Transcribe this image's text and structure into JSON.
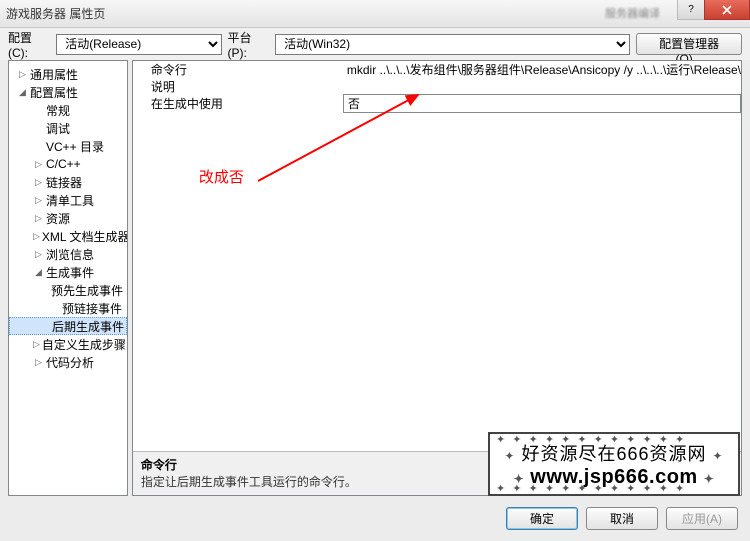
{
  "window": {
    "title": "游戏服务器 属性页",
    "blurred_hint": "服务器编译"
  },
  "toolbar": {
    "config_label": "配置(C):",
    "config_value": "活动(Release)",
    "platform_label": "平台(P):",
    "platform_value": "活动(Win32)",
    "manager_button": "配置管理器(O)..."
  },
  "tree": [
    {
      "label": "通用属性",
      "level": 0,
      "exp": "▷"
    },
    {
      "label": "配置属性",
      "level": 0,
      "exp": "◢"
    },
    {
      "label": "常规",
      "level": 1,
      "exp": ""
    },
    {
      "label": "调试",
      "level": 1,
      "exp": ""
    },
    {
      "label": "VC++ 目录",
      "level": 1,
      "exp": ""
    },
    {
      "label": "C/C++",
      "level": 1,
      "exp": "▷"
    },
    {
      "label": "链接器",
      "level": 1,
      "exp": "▷"
    },
    {
      "label": "清单工具",
      "level": 1,
      "exp": "▷"
    },
    {
      "label": "资源",
      "level": 1,
      "exp": "▷"
    },
    {
      "label": "XML 文档生成器",
      "level": 1,
      "exp": "▷"
    },
    {
      "label": "浏览信息",
      "level": 1,
      "exp": "▷"
    },
    {
      "label": "生成事件",
      "level": 1,
      "exp": "◢"
    },
    {
      "label": "预先生成事件",
      "level": 2,
      "exp": ""
    },
    {
      "label": "预链接事件",
      "level": 2,
      "exp": ""
    },
    {
      "label": "后期生成事件",
      "level": 2,
      "exp": "",
      "selected": true
    },
    {
      "label": "自定义生成步骤",
      "level": 1,
      "exp": "▷"
    },
    {
      "label": "代码分析",
      "level": 1,
      "exp": "▷"
    }
  ],
  "grid": {
    "rows": [
      {
        "k": "命令行",
        "v": "mkdir ..\\..\\..\\发布组件\\服务器组件\\Release\\Ansicopy /y ..\\..\\..\\运行\\Release\\"
      },
      {
        "k": "说明",
        "v": ""
      },
      {
        "k": "在生成中使用",
        "v": "否",
        "selected": true
      }
    ]
  },
  "annotation": "改成否",
  "desc": {
    "title": "命令行",
    "body": "指定让后期生成事件工具运行的命令行。"
  },
  "watermark": {
    "line1": "好资源尽在666资源网",
    "line2": "www.jsp666.com",
    "star": "✦"
  },
  "footer": {
    "ok": "确定",
    "cancel": "取消",
    "apply": "应用(A)"
  }
}
